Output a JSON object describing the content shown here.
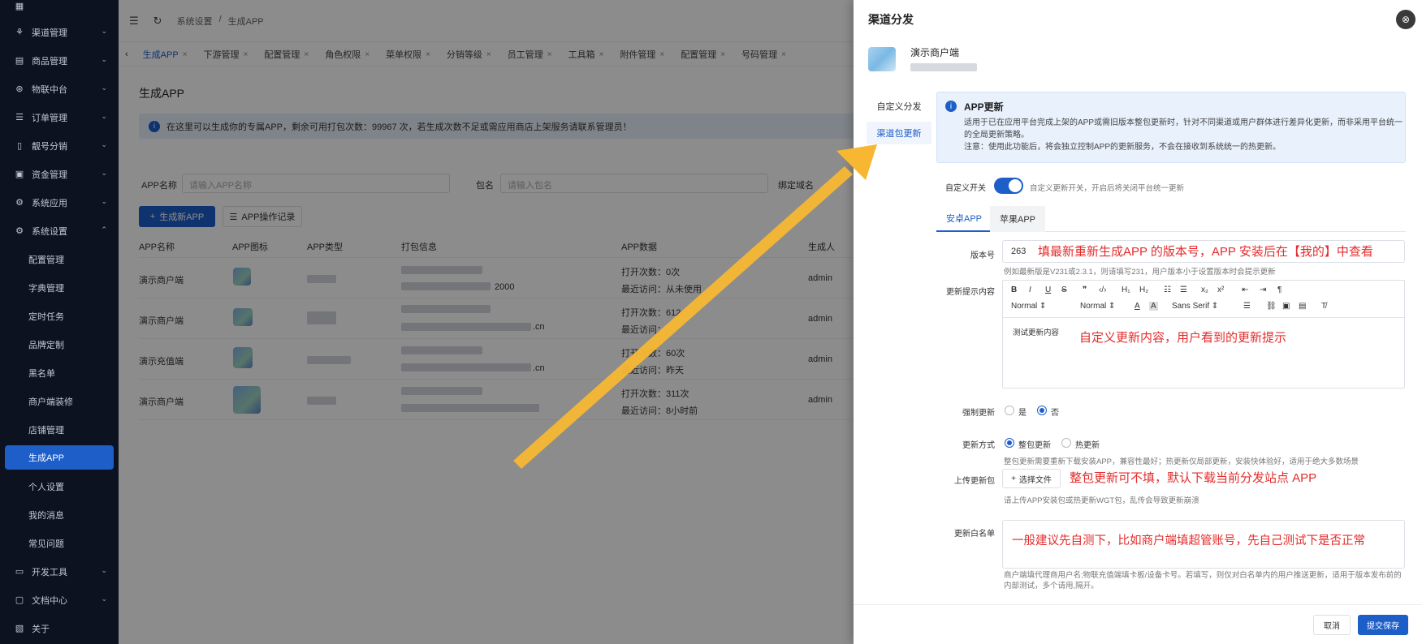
{
  "sidebar": {
    "items": [
      {
        "label": "渠道管理",
        "icon": "channel-icon",
        "expand": true
      },
      {
        "label": "商品管理",
        "icon": "goods-icon",
        "expand": true
      },
      {
        "label": "物联中台",
        "icon": "iot-icon",
        "expand": true
      },
      {
        "label": "订单管理",
        "icon": "order-icon",
        "expand": true
      },
      {
        "label": "靓号分销",
        "icon": "phone-icon",
        "expand": true
      },
      {
        "label": "资金管理",
        "icon": "fund-icon",
        "expand": true
      },
      {
        "label": "系统应用",
        "icon": "app-icon",
        "expand": true
      },
      {
        "label": "系统设置",
        "icon": "settings-icon",
        "expand": true
      }
    ],
    "sub_items": [
      "配置管理",
      "字典管理",
      "定时任务",
      "品牌定制",
      "黑名单",
      "商户端装修",
      "店铺管理",
      "生成APP",
      "个人设置",
      "我的消息",
      "常见问题"
    ],
    "bottom_items": [
      {
        "label": "开发工具",
        "icon": "dev-icon"
      },
      {
        "label": "文档中心",
        "icon": "doc-icon"
      },
      {
        "label": "关于",
        "icon": "about-icon"
      }
    ]
  },
  "topbar": {
    "breadcrumb1": "系统设置",
    "sep": "/",
    "breadcrumb2": "生成APP"
  },
  "tabs": [
    "生成APP",
    "下游管理",
    "配置管理",
    "角色权限",
    "菜单权限",
    "分销等级",
    "员工管理",
    "工具箱",
    "附件管理",
    "配置管理",
    "号码管理"
  ],
  "main": {
    "title": "生成APP",
    "notice": "在这里可以生成你的专属APP，剩余可用打包次数：99967 次，若生成次数不足或需应用商店上架服务请联系管理员！",
    "filter_name": "APP名称",
    "filter_name_ph": "请输入APP名称",
    "filter_pkg": "包名",
    "filter_pkg_ph": "请输入包名",
    "filter_domain": "绑定域名",
    "btn_create": "生成新APP",
    "btn_log": "APP操作记录",
    "columns": [
      "APP名称",
      "APP图标",
      "APP类型",
      "打包信息",
      "APP数据",
      "生成人"
    ],
    "rows": [
      {
        "name": "演示商户端",
        "open": "打开次数：0次",
        "visit": "最近访问：从未使用",
        "pkg_tail": "2000",
        "creator": "admin"
      },
      {
        "name": "演示商户端",
        "open": "打开次数：612",
        "visit": "最近访问：",
        "pkg_tail": ".cn",
        "creator": "admin"
      },
      {
        "name": "演示充值端",
        "open": "打开次数：60次",
        "visit": "最近访问：昨天",
        "pkg_tail": ".cn",
        "creator": "admin"
      },
      {
        "name": "演示商户端",
        "open": "打开次数：311次",
        "visit": "最近访问：8小时前",
        "pkg_tail": "",
        "creator": "admin"
      }
    ]
  },
  "drawer": {
    "title": "渠道分发",
    "merchant": "演示商户端",
    "nav": [
      "自定义分发",
      "渠道包更新"
    ],
    "info_title": "APP更新",
    "info_body1": "适用于已在应用平台完成上架的APP或需旧版本整包更新时，针对不同渠道或用户群体进行差异化更新，而非采用平台统一的全局更新策略。",
    "info_body2": "注意：使用此功能后，将会独立控制APP的更新服务，不会在接收到系统统一的热更新。",
    "switch_label": "自定义开关",
    "switch_hint": "自定义更新开关，开启后将关闭平台统一更新",
    "tab_android": "安卓APP",
    "tab_ios": "苹果APP",
    "version_label": "版本号",
    "version_value": "263",
    "version_note": "填最新重新生成APP 的版本号，APP 安装后在【我的】中查看",
    "version_hint": "例如最新版是V231或2.3.1，则请填写231，用户版本小于设置版本时会提示更新",
    "content_label": "更新提示内容",
    "editor_sel1": "Normal",
    "editor_sel2": "Normal",
    "editor_font": "Sans Serif",
    "editor_text": "测试更新内容",
    "editor_note": "自定义更新内容，用户看到的更新提示",
    "force_label": "强制更新",
    "yes": "是",
    "no": "否",
    "method_label": "更新方式",
    "method_full": "整包更新",
    "method_hot": "热更新",
    "method_hint": "整包更新需要重新下载安装APP，兼容性最好；热更新仅局部更新，安装快体验好，适用于绝大多数场景",
    "upload_label": "上传更新包",
    "upload_btn": "选择文件",
    "upload_note": "整包更新可不填，默认下载当前分发站点 APP",
    "upload_hint": "请上传APP安装包或热更新WGT包，乱传会导致更新崩溃",
    "whitelist_label": "更新白名单",
    "whitelist_note": "一般建议先自测下，比如商户端填超管账号，先自己测试下是否正常",
    "whitelist_hint": "商户端填代理商用户名;物联充值端填卡板/设备卡号。若填写，则仅对白名单内的用户推送更新，适用于版本发布前的内部测试，多个请用,隔开。",
    "cancel": "取消",
    "submit": "提交保存"
  },
  "colors": {
    "accent": "#1d5ec9",
    "sidebar_bg": "#0c1220",
    "note_red": "#e32c2c",
    "arrow": "#f7b733"
  }
}
